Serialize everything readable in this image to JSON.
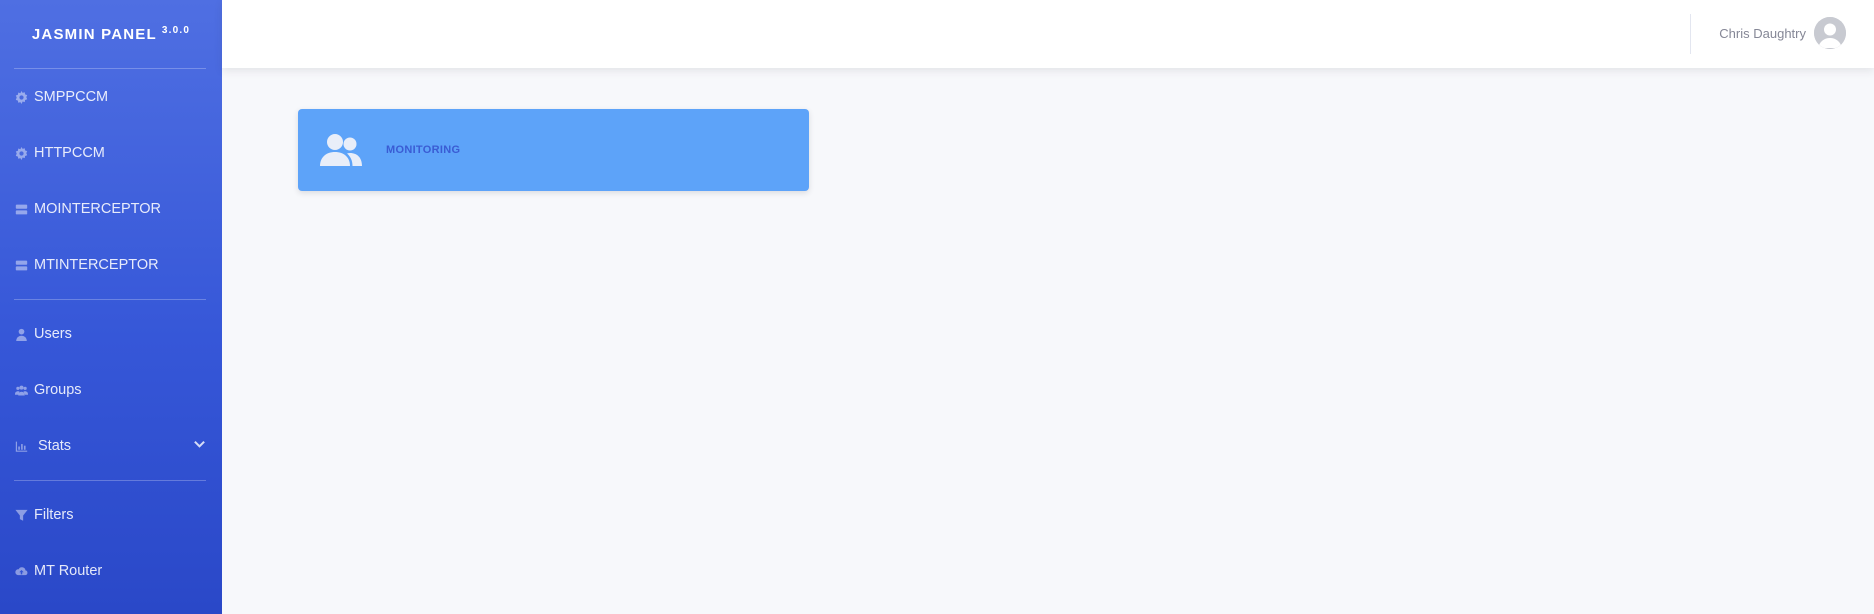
{
  "brand": {
    "name": "JASMIN PANEL",
    "version": "3.0.0"
  },
  "sidebar": {
    "group1": [
      {
        "label": "SMPPCCM",
        "icon": "gear-icon"
      },
      {
        "label": "HTTPCCM",
        "icon": "gear-icon"
      },
      {
        "label": "MOINTERCEPTOR",
        "icon": "server-icon"
      },
      {
        "label": "MTINTERCEPTOR",
        "icon": "server-icon"
      }
    ],
    "group2": [
      {
        "label": "Users",
        "icon": "user-icon"
      },
      {
        "label": "Groups",
        "icon": "users-icon"
      },
      {
        "label": "Stats",
        "icon": "chart-icon",
        "expandable": true
      }
    ],
    "group3": [
      {
        "label": "Filters",
        "icon": "filter-icon"
      },
      {
        "label": "MT Router",
        "icon": "cloud-upload-icon"
      }
    ]
  },
  "topbar": {
    "user_name": "Chris Daughtry"
  },
  "main": {
    "card": {
      "title": "MONITORING",
      "icon": "users-icon"
    }
  },
  "colors": {
    "sidebar": "#3f61dc",
    "card": "#5da3f9",
    "card_text": "#3a5cd4",
    "background": "#f7f8fb"
  }
}
